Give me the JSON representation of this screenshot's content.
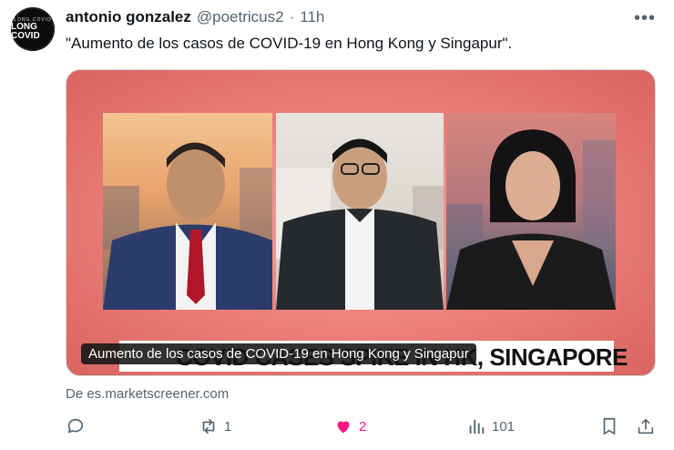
{
  "tweet": {
    "avatar_text_top": "LONG COVID",
    "avatar_text_main": "LONG COVID",
    "author_name": "antonio gonzalez",
    "handle": "@poetricus2",
    "separator": "·",
    "time": "11h",
    "text": "\"Aumento de los casos de COVID-19 en Hong Kong y Singapur\".",
    "media": {
      "subtitle": "Aumento de los casos de COVID-19 en Hong Kong y Singapur",
      "lower_third": "COVID CASES SPIKE IN HK, SINGAPORE"
    },
    "source_text": "De es.marketscreener.com",
    "actions": {
      "reply_count": "",
      "retweet_count": "1",
      "like_count": "2",
      "views_count": "101"
    },
    "like_color": "#f91880"
  }
}
